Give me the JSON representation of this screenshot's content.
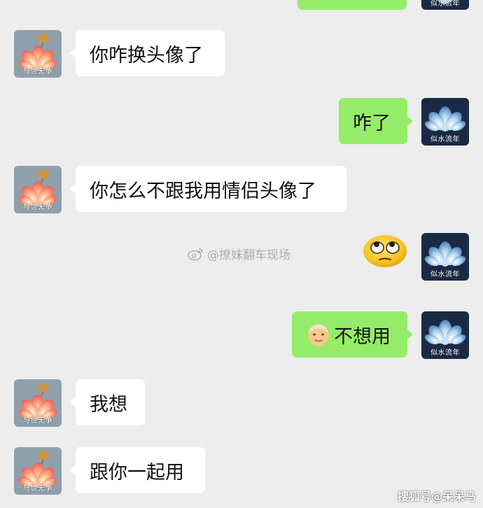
{
  "friend": {
    "avatar_caption": "与世无争"
  },
  "me": {
    "avatar_caption": "似水流年"
  },
  "messages": [
    {
      "side": "left",
      "text": "你咋换头像了"
    },
    {
      "side": "right",
      "text": "咋了"
    },
    {
      "side": "left",
      "text": "你怎么不跟我用情侣头像了"
    },
    {
      "side": "right",
      "emoji": "rolling-eyes-emoji"
    },
    {
      "side": "right",
      "emoji": "old-man-emoji",
      "text": "不想用"
    },
    {
      "side": "left",
      "text": "我想"
    },
    {
      "side": "left",
      "text": "跟你一起用"
    }
  ],
  "watermark": {
    "text": "@撩妹翻车现场"
  },
  "corner_watermark": {
    "text": "搜狐号@呆呆马"
  },
  "colors": {
    "background": "#ededed",
    "incoming_bubble": "#ffffff",
    "outgoing_bubble": "#95ec69",
    "friend_avatar_bg": "#8fa0ad",
    "my_avatar_bg": "#1b2a44"
  }
}
